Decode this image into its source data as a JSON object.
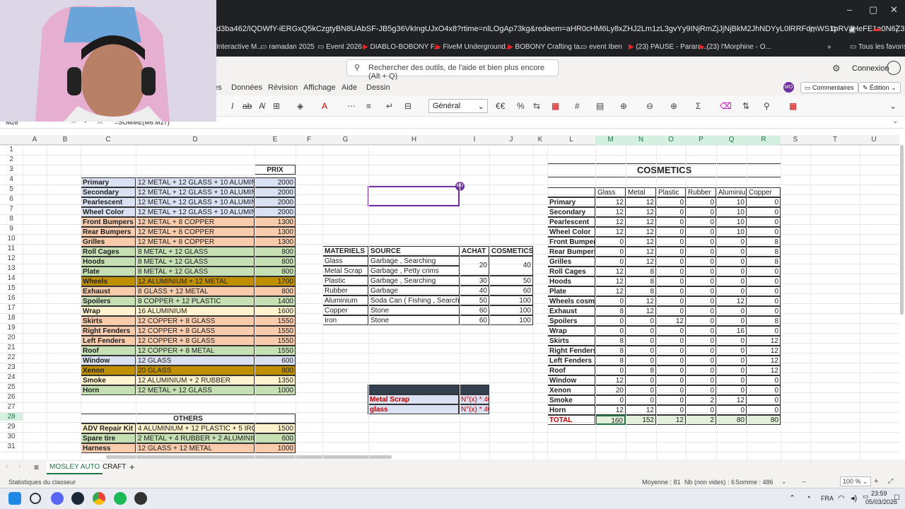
{
  "browser": {
    "url": "d3ba462/IQDWfY-iERGxQ5kCzgtyBN8UAbSF-JB5g36VkIngUJxO4x8?rtime=nlLOgAp73kg&redeem=aHR0cHM6Ly8xZHJ2Lm1zL3gvYy9INjRmZjJjNjBkM2JhNDYyL0lRRFdmWS1pRVJHeFE1a0N6Z3R5Qk44...",
    "bookmarks": [
      "Interactive M...",
      "ramadan 2025",
      "Event 2026",
      "DIABLO-BOBONY F...",
      "FiveM Underground...",
      "BOBONY Crafting ta...",
      "event Iben",
      "(23) PAUSE - Parara...",
      "(23) l'Morphine - O..."
    ],
    "all_bookmarks": "Tous les favoris"
  },
  "office": {
    "search_placeholder": "Rechercher des outils, de l'aide et bien plus encore (Alt + Q)",
    "signin": "Connexion",
    "menus": [
      "es",
      "Données",
      "Révision",
      "Affichage",
      "Aide",
      "Dessin"
    ],
    "comments": "Commentaires",
    "edit_mode": "Édition",
    "avatar": "MO",
    "number_format": "Général",
    "currency": "€",
    "namebox": "M28",
    "formula": "=SOMME(M6:M27)"
  },
  "grid": {
    "columns": [
      "A",
      "B",
      "C",
      "D",
      "E",
      "F",
      "G",
      "H",
      "I",
      "J",
      "K",
      "L",
      "M",
      "N",
      "O",
      "P",
      "Q",
      "R",
      "S",
      "T",
      "U"
    ],
    "rows": [
      "1",
      "2",
      "3",
      "4",
      "5",
      "6",
      "7",
      "8",
      "9",
      "10",
      "11",
      "12",
      "13",
      "14",
      "15",
      "16",
      "17",
      "18",
      "19",
      "20",
      "21",
      "22",
      "23",
      "24",
      "25",
      "26",
      "27",
      "28",
      "29",
      "30",
      "31"
    ]
  },
  "pricing": {
    "header": "PRIX",
    "rows": [
      {
        "name": "Primary",
        "recipe": "12 METAL + 12 GLASS + 10 ALUMINIUM",
        "price": "2000",
        "color": "#d9e1f2"
      },
      {
        "name": "Secondary",
        "recipe": "12 METAL + 12 GLASS + 10 ALUMINIUM",
        "price": "2000",
        "color": "#d9e1f2"
      },
      {
        "name": "Pearlescent",
        "recipe": "12 METAL + 12 GLASS + 10 ALUMINIUM",
        "price": "2000",
        "color": "#d9e1f2"
      },
      {
        "name": "Wheel Color",
        "recipe": "12 METAL + 12 GLASS + 10 ALUMINIUM",
        "price": "2000",
        "color": "#d9e1f2"
      },
      {
        "name": "Front Bumpers",
        "recipe": "12 METAL + 8 COPPER",
        "price": "1300",
        "color": "#f8cbad"
      },
      {
        "name": "Rear Bumpers",
        "recipe": "12 METAL + 8 COPPER",
        "price": "1300",
        "color": "#f8cbad"
      },
      {
        "name": "Grilles",
        "recipe": "12 METAL + 8 COPPER",
        "price": "1300",
        "color": "#f8cbad"
      },
      {
        "name": "Roll Cages",
        "recipe": "8 METAL + 12 GLASS",
        "price": "800",
        "color": "#c6e0b4"
      },
      {
        "name": "Hoods",
        "recipe": "8 METAL + 12 GLASS",
        "price": "800",
        "color": "#c6e0b4"
      },
      {
        "name": "Plate",
        "recipe": "8 METAL + 12 GLASS",
        "price": "800",
        "color": "#c6e0b4"
      },
      {
        "name": "Wheels",
        "recipe": "12 ALUMINIUM + 12 METAL",
        "price": "1700",
        "color": "#bf8f00"
      },
      {
        "name": "Exhaust",
        "recipe": "8 GLASS + 12 METAL",
        "price": "800",
        "color": "#f8cbad"
      },
      {
        "name": "Spoilers",
        "recipe": "8 COPPER + 12 PLASTIC",
        "price": "1400",
        "color": "#c6e0b4"
      },
      {
        "name": "Wrap",
        "recipe": "16 ALUMINIUM",
        "price": "1600",
        "color": "#fff2cc"
      },
      {
        "name": "Skirts",
        "recipe": "12 COPPER + 8 GLASS",
        "price": "1550",
        "color": "#f8cbad"
      },
      {
        "name": "Right Fenders",
        "recipe": "12 COPPER + 8 GLASS",
        "price": "1550",
        "color": "#f8cbad"
      },
      {
        "name": "Left Fenders",
        "recipe": "12 COPPER + 8 GLASS",
        "price": "1550",
        "color": "#f8cbad"
      },
      {
        "name": "Roof",
        "recipe": "12 COPPER + 8 METAL",
        "price": "1550",
        "color": "#c6e0b4"
      },
      {
        "name": "Window",
        "recipe": "12 GLASS",
        "price": "600",
        "color": "#d9e1f2"
      },
      {
        "name": "Xenon",
        "recipe": "20 GLASS",
        "price": "800",
        "color": "#bf8f00"
      },
      {
        "name": "Smoke",
        "recipe": "12 ALUMINIUM + 2 RUBBER",
        "price": "1350",
        "color": "#fff2cc"
      },
      {
        "name": "Horn",
        "recipe": "12 METAL + 12 GLASS",
        "price": "1000",
        "color": "#c6e0b4"
      }
    ]
  },
  "others": {
    "header": "OTHERS",
    "rows": [
      {
        "name": "ADV Repair Kit",
        "recipe": "4 ALUMINIUM + 12 PLASTIC + 5 IRON",
        "price": "1500",
        "color": "#fff2cc"
      },
      {
        "name": "Spare tire",
        "recipe": "2 METAL + 4 RUBBER + 2 ALUMINIUM",
        "price": "600",
        "color": "#c6e0b4"
      },
      {
        "name": "Harness",
        "recipe": "12 GLASS + 12 METAL",
        "price": "1000",
        "color": "#f8cbad"
      }
    ]
  },
  "materials": {
    "headers": [
      "MATERIELS",
      "SOURCE",
      "ACHAT",
      "COSMETICS"
    ],
    "rows": [
      {
        "name": "Glass",
        "source": "Garbage , Searching",
        "achat": "20",
        "cosmetics": "40"
      },
      {
        "name": "Metal Scrap",
        "source": "Garbage , Petty crims",
        "achat": "",
        "cosmetics": ""
      },
      {
        "name": "Plastic",
        "source": "Garbage , Searching",
        "achat": "30",
        "cosmetics": "50"
      },
      {
        "name": "Rubber",
        "source": "Garbage",
        "achat": "40",
        "cosmetics": "60"
      },
      {
        "name": "Aluminium",
        "source": "Soda Can ( Fishing , Searching )",
        "achat": "50",
        "cosmetics": "100"
      },
      {
        "name": "Copper",
        "source": "Stone",
        "achat": "60",
        "cosmetics": "100"
      },
      {
        "name": "Iron",
        "source": "Stone",
        "achat": "60",
        "cosmetics": "100"
      }
    ]
  },
  "extra": {
    "rows": [
      {
        "name": "Metal Scrap",
        "formula": "N°(x) * 40"
      },
      {
        "name": "glass",
        "formula": "N°(x) * 40"
      }
    ]
  },
  "cosmetics": {
    "title": "COSMETICS",
    "headers": [
      "Glass",
      "Metal",
      "Plastic",
      "Rubber",
      "Aluminium",
      "Copper"
    ],
    "rows": [
      {
        "name": "Primary",
        "v": [
          "12",
          "12",
          "0",
          "0",
          "10",
          "0"
        ]
      },
      {
        "name": "Secondary",
        "v": [
          "12",
          "12",
          "0",
          "0",
          "10",
          "0"
        ]
      },
      {
        "name": "Pearlescent",
        "v": [
          "12",
          "12",
          "0",
          "0",
          "10",
          "0"
        ]
      },
      {
        "name": "Wheel Color",
        "v": [
          "12",
          "12",
          "0",
          "0",
          "10",
          "0"
        ]
      },
      {
        "name": "Front Bumpers",
        "v": [
          "0",
          "12",
          "0",
          "0",
          "0",
          "8"
        ]
      },
      {
        "name": "Rear Bumpers",
        "v": [
          "0",
          "12",
          "0",
          "0",
          "0",
          "8"
        ]
      },
      {
        "name": "Grilles",
        "v": [
          "0",
          "12",
          "0",
          "0",
          "0",
          "8"
        ]
      },
      {
        "name": "Roll Cages",
        "v": [
          "12",
          "8",
          "0",
          "0",
          "0",
          "0"
        ]
      },
      {
        "name": "Hoods",
        "v": [
          "12",
          "8",
          "0",
          "0",
          "0",
          "0"
        ]
      },
      {
        "name": "Plate",
        "v": [
          "12",
          "8",
          "0",
          "0",
          "0",
          "0"
        ]
      },
      {
        "name": "Wheels cosm",
        "v": [
          "0",
          "12",
          "0",
          "0",
          "12",
          "0"
        ]
      },
      {
        "name": "Exhaust",
        "v": [
          "8",
          "12",
          "0",
          "0",
          "0",
          "0"
        ]
      },
      {
        "name": "Spoilers",
        "v": [
          "0",
          "0",
          "12",
          "0",
          "0",
          "8"
        ]
      },
      {
        "name": "Wrap",
        "v": [
          "0",
          "0",
          "0",
          "0",
          "16",
          "0"
        ]
      },
      {
        "name": "Skirts",
        "v": [
          "8",
          "0",
          "0",
          "0",
          "0",
          "12"
        ]
      },
      {
        "name": "Right Fenders",
        "v": [
          "8",
          "0",
          "0",
          "0",
          "0",
          "12"
        ]
      },
      {
        "name": "Left Fenders",
        "v": [
          "8",
          "0",
          "0",
          "0",
          "0",
          "12"
        ]
      },
      {
        "name": "Roof",
        "v": [
          "0",
          "8",
          "0",
          "0",
          "0",
          "12"
        ]
      },
      {
        "name": "Window",
        "v": [
          "12",
          "0",
          "0",
          "0",
          "0",
          "0"
        ]
      },
      {
        "name": "Xenon",
        "v": [
          "20",
          "0",
          "0",
          "0",
          "0",
          "0"
        ]
      },
      {
        "name": "Smoke",
        "v": [
          "0",
          "0",
          "0",
          "2",
          "12",
          "0"
        ]
      },
      {
        "name": "Horn",
        "v": [
          "12",
          "12",
          "0",
          "0",
          "0",
          "0"
        ]
      }
    ],
    "total_label": "TOTAL",
    "totals": [
      "160",
      "152",
      "12",
      "2",
      "80",
      "80"
    ]
  },
  "sheets": {
    "tabs": [
      "MOSLEY AUTO",
      "CRAFT"
    ],
    "add": "+"
  },
  "status": {
    "left": "Statistiques du classeur",
    "average": "Moyenne : 81",
    "count": "Nb (non vides) : 6",
    "sum": "Somme : 486",
    "zoom": "100 %"
  },
  "taskbar": {
    "lang": "FRA",
    "time": "23:59",
    "date": "05/03/2026"
  },
  "colors": {
    "accent": "#217346",
    "selection": "#7030a0"
  }
}
